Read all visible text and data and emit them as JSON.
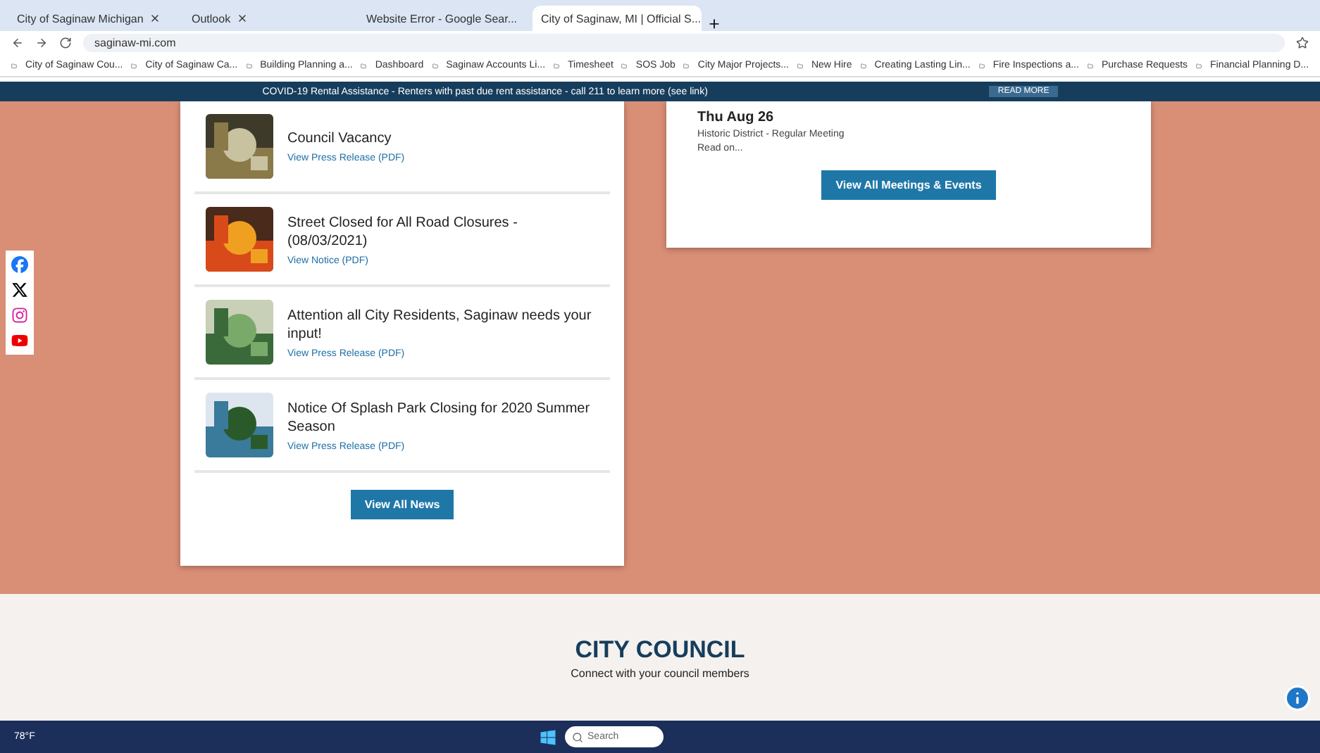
{
  "browser": {
    "tabs": [
      {
        "title": "City of Saginaw Michigan",
        "selected": false
      },
      {
        "title": "Outlook",
        "selected": false
      },
      {
        "title": "Website Error - Google Sear...",
        "selected": false
      },
      {
        "title": "City of Saginaw, MI | Official S...",
        "selected": true
      }
    ],
    "address": "saginaw-mi.com",
    "bookmarks": [
      "City of Saginaw Cou...",
      "City of Saginaw Ca...",
      "Building Planning a...",
      "Dashboard",
      "Saginaw Accounts Li...",
      "Timesheet",
      "SOS Job",
      "City Major Projects...",
      "New Hire",
      "Creating Lasting Lin...",
      "Fire Inspections a...",
      "Purchase Requests",
      "Financial Planning D..."
    ]
  },
  "alert_bar": {
    "text": "COVID-19 Rental Assistance - Renters with past due rent assistance - call 211 to learn more (see link)",
    "button": "READ MORE"
  },
  "social": [
    {
      "kind": "facebook"
    },
    {
      "kind": "x"
    },
    {
      "kind": "instagram"
    },
    {
      "kind": "youtube"
    }
  ],
  "news": {
    "items": [
      {
        "title": "Council Vacancy",
        "link": "View Press Release (PDF)"
      },
      {
        "title": "Street Closed for All Road Closures - (08/03/2021)",
        "link": "View Notice (PDF)"
      },
      {
        "title": "Attention all City Residents, Saginaw needs your input!",
        "link": "View Press Release (PDF)"
      },
      {
        "title": "Notice Of Splash Park Closing for 2020 Summer Season",
        "link": "View Press Release (PDF)"
      }
    ],
    "button": "View All News"
  },
  "events": {
    "date": "Thu Aug 26",
    "title": "Historic District - Regular Meeting",
    "more": "Read on...",
    "button": "View All Meetings & Events"
  },
  "council": {
    "heading": "CITY COUNCIL",
    "subheading": "Connect with your council members"
  },
  "taskbar": {
    "weather": "78°F",
    "search": "Search"
  }
}
